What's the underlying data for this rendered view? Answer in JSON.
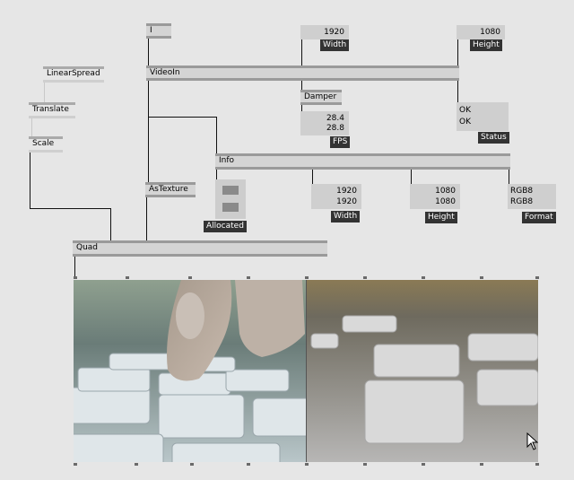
{
  "nodes": {
    "io_switch": "I",
    "videoin": "VideoIn",
    "linearspread": "LinearSpread",
    "translate": "Translate",
    "scale": "Scale",
    "damper": "Damper",
    "info": "Info",
    "astexture": "AsTexture",
    "quad": "Quad"
  },
  "width_io": {
    "value": "1920",
    "label": "Width"
  },
  "height_io": {
    "value": "1080",
    "label": "Height"
  },
  "fps_io": {
    "values": [
      "28.4",
      "28.8"
    ],
    "label": "FPS"
  },
  "status_io": {
    "values": [
      "OK",
      "OK"
    ],
    "label": "Status"
  },
  "allocated_io": {
    "label": "Allocated"
  },
  "info_width": {
    "values": [
      "1920",
      "1920"
    ],
    "label": "Width"
  },
  "info_height": {
    "values": [
      "1080",
      "1080"
    ],
    "label": "Height"
  },
  "info_format": {
    "values": [
      "RGB8",
      "RGB8"
    ],
    "label": "Format"
  },
  "colors": {
    "wire": "#111111",
    "node": "#d4d4d4",
    "bar": "#9a9a9a",
    "tag": "#333333"
  }
}
